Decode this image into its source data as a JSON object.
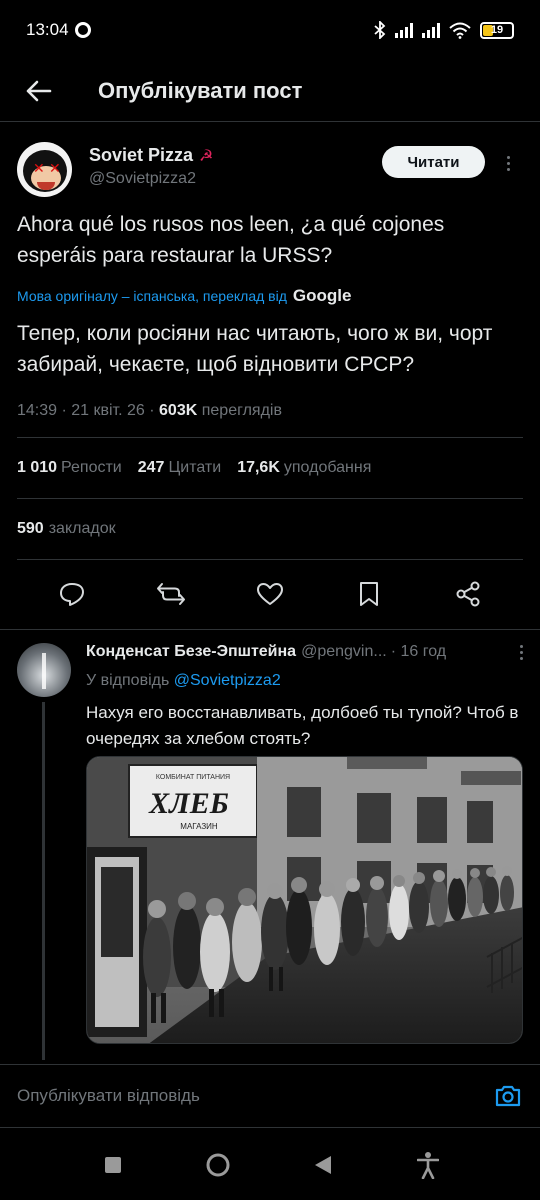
{
  "status_bar": {
    "time": "13:04",
    "battery": "19"
  },
  "header": {
    "title": "Опублікувати пост"
  },
  "post": {
    "author": {
      "display_name": "Soviet Pizza",
      "handle": "@Sovietpizza2",
      "emoji": "☭"
    },
    "follow_label": "Читати",
    "original_text": "Ahora qué los rusos nos leen, ¿a qué cojones esperáis para restaurar la URSS?",
    "translation_note": "Мова оригіналу – іспанська, переклад від",
    "translation_provider": "Google",
    "translated_text": "Тепер, коли росіяни нас читають, чого ж ви, чорт забирай, чекаєте, щоб відновити СРСР?",
    "timestamp": "14:39 · 21 квіт. 26 ·",
    "views_count": "603K",
    "views_label": "переглядів",
    "stats": [
      {
        "count": "1 010",
        "label": "Репости"
      },
      {
        "count": "247",
        "label": "Цитати"
      },
      {
        "count": "17,6K",
        "label": "уподобання"
      }
    ],
    "bookmarks": {
      "count": "590",
      "label": "закладок"
    },
    "action_icons": [
      "reply-icon",
      "repost-icon",
      "like-icon",
      "bookmark-icon",
      "share-icon"
    ]
  },
  "reply": {
    "display_name": "Конденсат Безе-Эпштейна",
    "handle": "@pengvin...",
    "time": "· 16 год",
    "replying_to_label": "У відповідь",
    "replying_to_handle": "@Sovietpizza2",
    "text": "Нахуя его восстанавливать, долбоеб ты тупой? Чтоб в очередях за хлебом стоять?",
    "image": {
      "sign_text": "ХЛЕБ",
      "sign_subtext": "МАГАЗИН",
      "top_text": "КОМБИНАТ ПИТАНИЯ"
    }
  },
  "compose": {
    "placeholder": "Опублікувати відповідь"
  },
  "colors": {
    "accent": "#1d9bf0",
    "background": "#000000",
    "text": "#e7e9ea",
    "muted": "#71767b",
    "border": "#2f3336"
  }
}
